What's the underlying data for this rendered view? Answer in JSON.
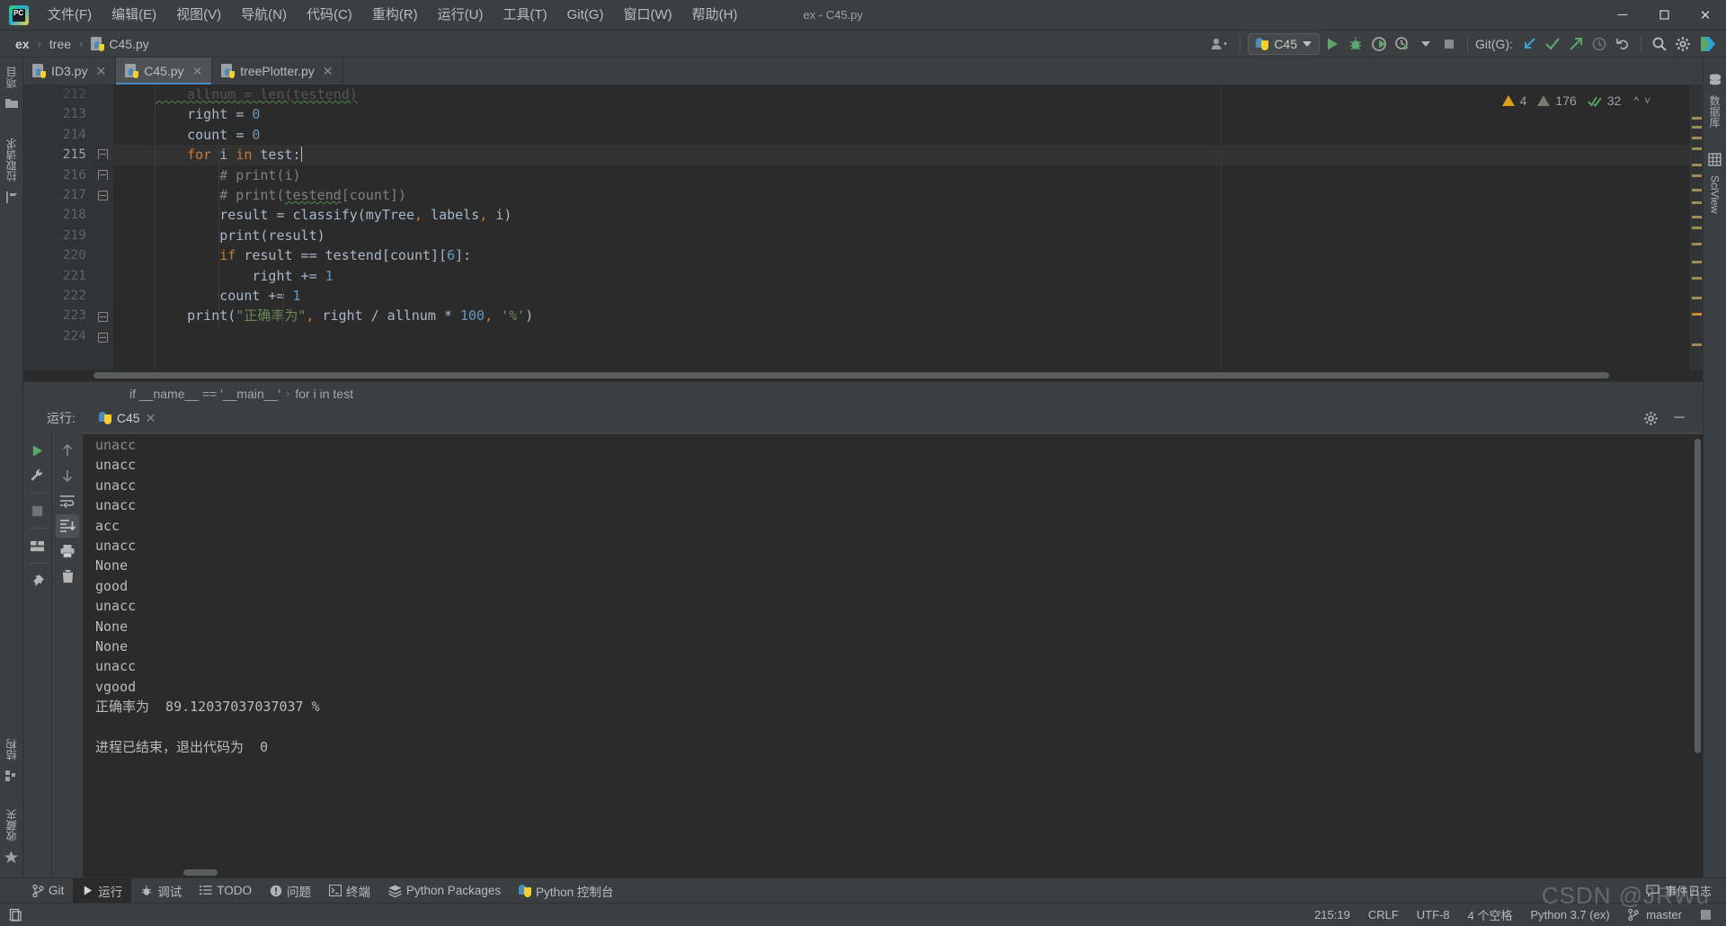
{
  "window": {
    "title": "ex - C45.py",
    "minimize_label": "─",
    "maximize_label": "❐",
    "close_label": "✕"
  },
  "menubar": {
    "items": [
      {
        "label": "文件(F)",
        "name": "menu-file"
      },
      {
        "label": "编辑(E)",
        "name": "menu-edit"
      },
      {
        "label": "视图(V)",
        "name": "menu-view"
      },
      {
        "label": "导航(N)",
        "name": "menu-navigate"
      },
      {
        "label": "代码(C)",
        "name": "menu-code"
      },
      {
        "label": "重构(R)",
        "name": "menu-refactor"
      },
      {
        "label": "运行(U)",
        "name": "menu-run"
      },
      {
        "label": "工具(T)",
        "name": "menu-tools"
      },
      {
        "label": "Git(G)",
        "name": "menu-git"
      },
      {
        "label": "窗口(W)",
        "name": "menu-window"
      },
      {
        "label": "帮助(H)",
        "name": "menu-help"
      }
    ]
  },
  "navbar": {
    "breadcrumbs": [
      "ex",
      "tree",
      "C45.py"
    ],
    "separator": "›",
    "run_config": "C45",
    "git_label": "Git(G):"
  },
  "editor": {
    "tabs": [
      {
        "label": "ID3.py",
        "active": false
      },
      {
        "label": "C45.py",
        "active": true
      },
      {
        "label": "treePlotter.py",
        "active": false
      }
    ],
    "first_line_number": 212,
    "lines": [
      {
        "num": "212",
        "text": "    allnum = len(testend)"
      },
      {
        "num": "213",
        "text": "    right = 0"
      },
      {
        "num": "214",
        "text": "    count = 0"
      },
      {
        "num": "215",
        "text": "    for i in test:"
      },
      {
        "num": "216",
        "text": "        # print(i)"
      },
      {
        "num": "217",
        "text": "        # print(testend[count])"
      },
      {
        "num": "218",
        "text": "        result = classify(myTree, labels, i)"
      },
      {
        "num": "219",
        "text": "        print(result)"
      },
      {
        "num": "220",
        "text": "        if result == testend[count][6]:"
      },
      {
        "num": "221",
        "text": "            right += 1"
      },
      {
        "num": "222",
        "text": "        count += 1"
      },
      {
        "num": "223",
        "text": "    print(\"正确率为\", right / allnum * 100, '%')"
      },
      {
        "num": "224",
        "text": ""
      }
    ],
    "inspections": {
      "warnings": "4",
      "weak_warnings": "176",
      "ok": "32"
    },
    "context_breadcrumb": [
      "if __name__ == '__main__'",
      "for i in test"
    ],
    "context_separator": "›"
  },
  "run_panel": {
    "title": "运行:",
    "tab_label": "C45",
    "close_label": "✕",
    "settings_label": "⚙",
    "minimize_label": "─",
    "tools_left": [
      {
        "name": "rerun-button",
        "icon": "play-icon"
      },
      {
        "name": "run-settings-button",
        "icon": "wrench-icon"
      },
      {
        "name": "stop-button",
        "icon": "stop-icon"
      },
      {
        "name": "layout-button",
        "icon": "layout-icon"
      },
      {
        "name": "pin-tab-button",
        "icon": "pin-icon"
      }
    ],
    "tools_right": [
      {
        "name": "up-stacktrace-button",
        "icon": "arrow-up-icon"
      },
      {
        "name": "down-stacktrace-button",
        "icon": "arrow-down-icon"
      },
      {
        "name": "soft-wrap-button",
        "icon": "soft-wrap-icon"
      },
      {
        "name": "scroll-to-end-button",
        "icon": "scroll-to-end-icon"
      },
      {
        "name": "print-button",
        "icon": "print-icon"
      },
      {
        "name": "clear-all-button",
        "icon": "trash-icon"
      }
    ],
    "console_lines": [
      "unacc",
      "unacc",
      "unacc",
      "unacc",
      "acc",
      "unacc",
      "None",
      "good",
      "unacc",
      "None",
      "None",
      "unacc",
      "vgood",
      "正确率为  89.12037037037037 %",
      "",
      "进程已结束，退出代码为  0"
    ]
  },
  "left_stripe": {
    "top_items": [
      {
        "label": "项目",
        "icon": "project-folder-icon"
      },
      {
        "label": "拉取请求",
        "icon": "pull-request-icon"
      }
    ],
    "bottom_items": [
      {
        "label": "结构",
        "icon": "structure-icon"
      },
      {
        "label": "收藏夹",
        "icon": "star-icon"
      }
    ]
  },
  "right_stripe": {
    "items": [
      {
        "label": "数据库",
        "icon": "database-icon"
      },
      {
        "label": "SciView",
        "icon": "grid-icon"
      }
    ]
  },
  "bottom_bar": {
    "items": [
      {
        "label": "Git",
        "icon": "git-branch-icon",
        "active": false
      },
      {
        "label": "运行",
        "icon": "play-icon",
        "active": true
      },
      {
        "label": "调试",
        "icon": "bug-icon",
        "active": false
      },
      {
        "label": "TODO",
        "icon": "todo-list-icon",
        "active": false
      },
      {
        "label": "问题",
        "icon": "problems-icon",
        "active": false
      },
      {
        "label": "终端",
        "icon": "terminal-icon",
        "active": false
      },
      {
        "label": "Python Packages",
        "icon": "packages-icon",
        "active": false
      },
      {
        "label": "Python 控制台",
        "icon": "python-console-icon",
        "active": false
      }
    ],
    "event_log": "事件日志"
  },
  "status_bar": {
    "caret_position": "215:19",
    "line_separator": "CRLF",
    "encoding": "UTF-8",
    "indent": "4 个空格",
    "interpreter": "Python 3.7 (ex)",
    "branch": "master"
  },
  "watermark": "CSDN @JRWu",
  "colors": {
    "accent": "#4a88c7",
    "background": "#3c3f41",
    "editor_bg": "#2b2b2b",
    "keyword": "#cc7832",
    "number": "#6897bb",
    "string": "#6a8759",
    "comment": "#808080",
    "green_run": "#59a869",
    "warning": "#d9a013"
  }
}
